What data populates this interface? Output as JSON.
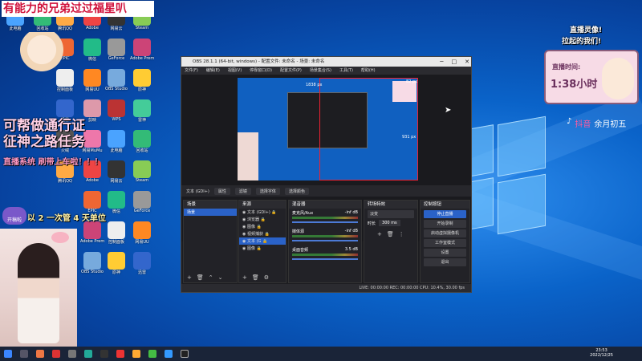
{
  "overlay": {
    "top_banner": "有能力的兄弟过过福星叭",
    "left_big_1": "可帮做通行证",
    "left_big_2": "征神之路任务",
    "left_mid": "直播系统 刷带上车啦！！！",
    "left_wave": "以 2 一次管 4 天单位",
    "left_tag": "开稿啦",
    "bubble_top": "直播灵像!",
    "bubble_top2": "拉起的我们!",
    "streamer_name": "余月初五",
    "douyin_label": "抖音",
    "hours_label": "直播时间:",
    "hours_value": "1:38小时"
  },
  "obs": {
    "title": "OBS 28.1.1 (64-bit, windows) - 配置文件: 未命名 - 场景: 未命名",
    "menu": [
      "文件(F)",
      "编辑(E)",
      "视图(V)",
      "停靠窗口(D)",
      "配置文件(P)",
      "场景集合(S)",
      "工具(T)",
      "帮助(H)"
    ],
    "preview_dim_w": "1838 px",
    "preview_dim_h": "931 px",
    "preview_dim_small": "82 px",
    "source_selected": "文本 (GDI+)",
    "srcbar": [
      "属性",
      "滤镜",
      "选择字体",
      "选择颜色"
    ],
    "docks": {
      "scenes_title": "场景",
      "sources_title": "来源",
      "mixer_title": "混音器",
      "transitions_title": "转场特效",
      "controls_title": "控制按钮"
    },
    "scenes": [
      "场景"
    ],
    "sources": [
      "文本 (GDI+)",
      "浏览器",
      "图像",
      "视频捕获",
      "文本 (G",
      "图像"
    ],
    "mixer": [
      {
        "name": "麦克风/Aux",
        "level": "-inf dB"
      },
      {
        "name": "媒体源",
        "level": "-inf dB"
      },
      {
        "name": "桌面音频",
        "level": "3.5 dB"
      }
    ],
    "transition": {
      "type": "淡变",
      "duration_label": "时长",
      "duration": "300 ms"
    },
    "controls": [
      "停止直播",
      "开始录制",
      "启动虚拟摄像机",
      "工作室模式",
      "设置",
      "退出"
    ],
    "status": "LIVE: 00:00:00   REC: 00:00:00   CPU: 10.4%, 30.00 fps"
  },
  "taskbar": {
    "time": "23:53",
    "date": "2022/12/25"
  },
  "desktop_icons": [
    "此电脑",
    "回收站",
    "腾讯QQ",
    "Adobe",
    "网易云",
    "Steam",
    "EPIC",
    "微信",
    "GeForce",
    "Adobe Premiere",
    "控制面板",
    "网易UU",
    "OBS Studio",
    "原神",
    "迅雷",
    "剪映",
    "WPS",
    "雷神",
    "火绒",
    "网易MuMu"
  ]
}
